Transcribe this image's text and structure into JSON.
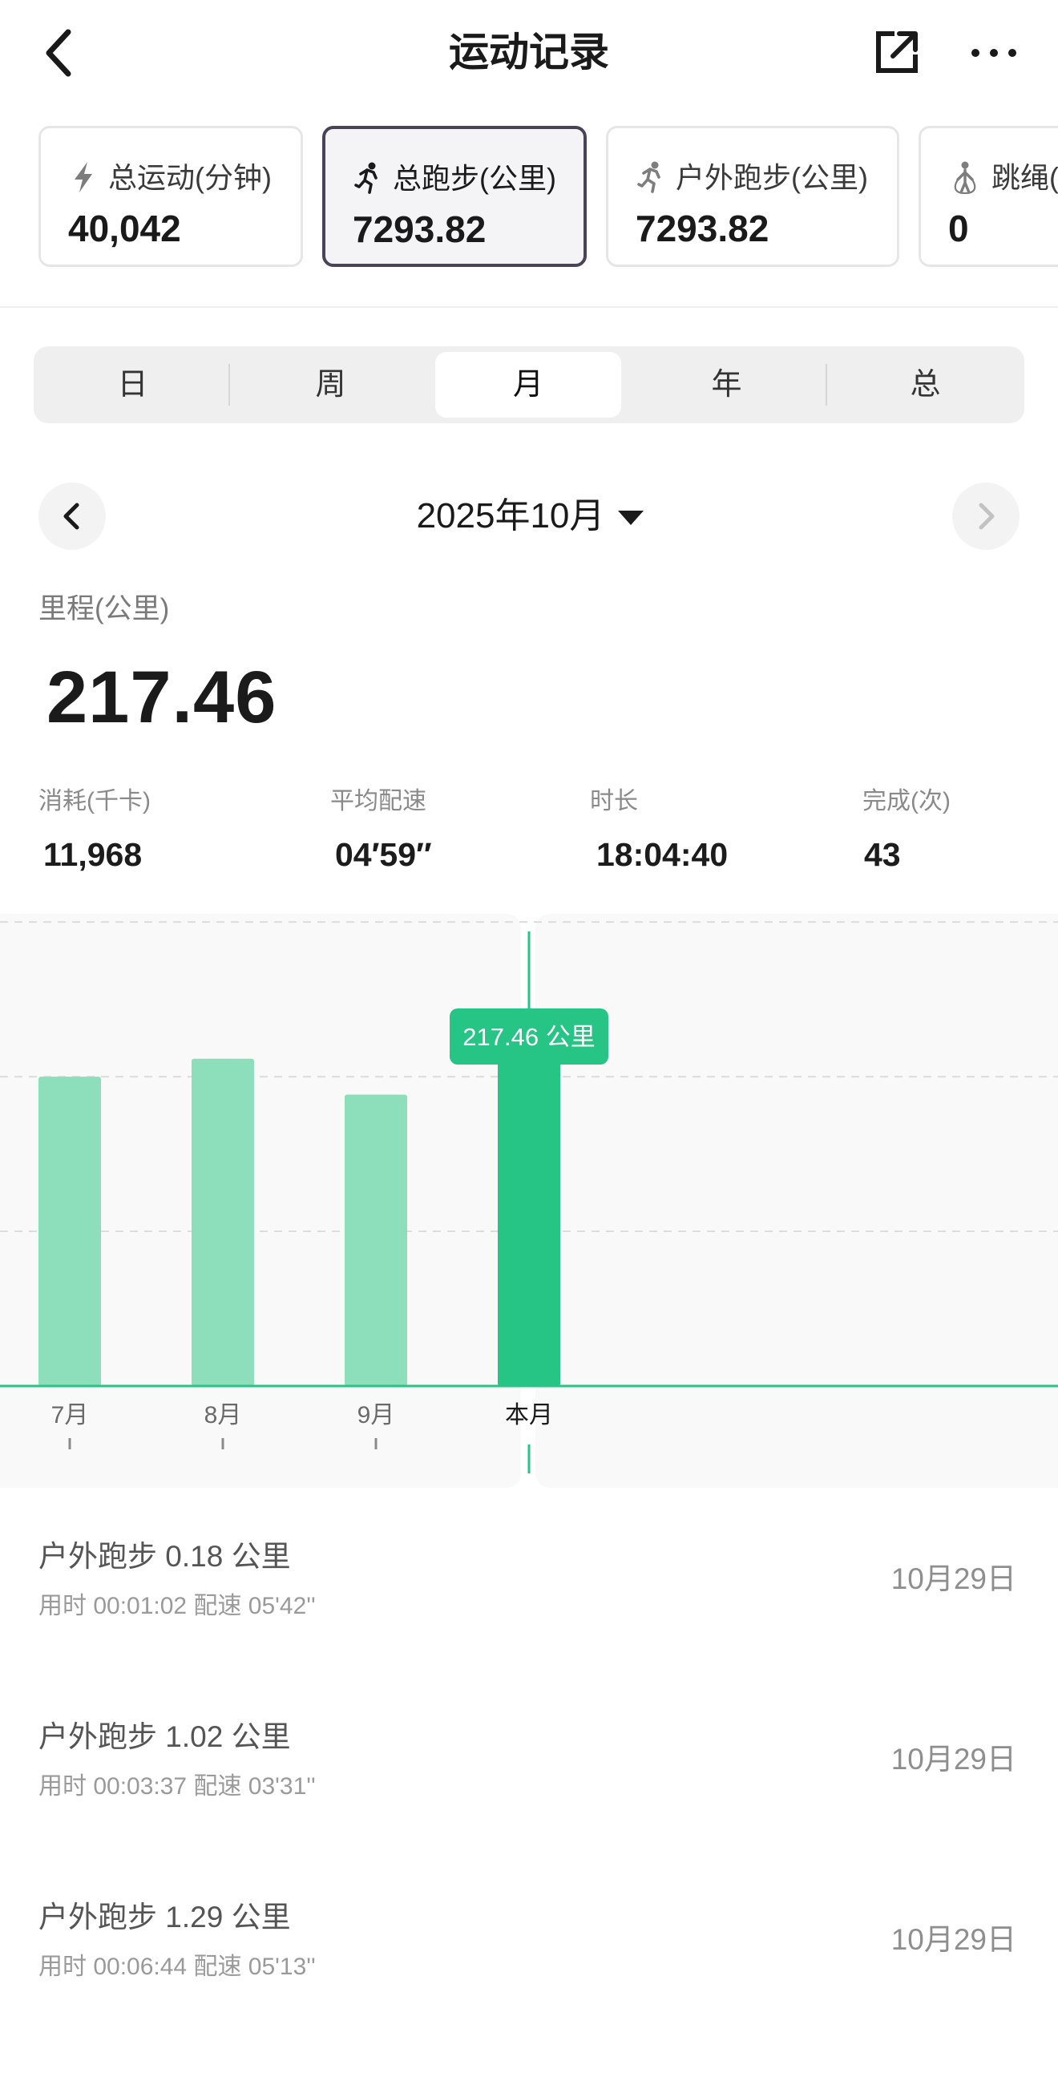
{
  "header": {
    "title": "运动记录"
  },
  "metric_cards": [
    {
      "label": "总运动(分钟)",
      "value": "40,042",
      "icon": "lightning-icon",
      "selected": false
    },
    {
      "label": "总跑步(公里)",
      "value": "7293.82",
      "icon": "runner-icon",
      "selected": true
    },
    {
      "label": "户外跑步(公里)",
      "value": "7293.82",
      "icon": "outdoor-runner-icon",
      "selected": false
    },
    {
      "label": "跳绳(",
      "value": "0",
      "icon": "jump-rope-icon",
      "selected": false
    }
  ],
  "period_tabs": {
    "items": [
      "日",
      "周",
      "月",
      "年",
      "总"
    ],
    "selected": "月"
  },
  "date_nav": {
    "label": "2025年10月"
  },
  "summary": {
    "distance_label": "里程(公里)",
    "distance_value": "217.46",
    "stats": [
      {
        "label": "消耗(千卡)",
        "value": "11,968"
      },
      {
        "label": "平均配速",
        "value": "04′59″"
      },
      {
        "label": "时长",
        "value": "18:04:40"
      },
      {
        "label": "完成(次)",
        "value": "43"
      }
    ]
  },
  "chart_data": {
    "type": "bar",
    "categories": [
      "7月",
      "8月",
      "9月",
      "本月"
    ],
    "values": [
      190,
      201,
      179,
      217.46
    ],
    "unit": "公里",
    "highlighted": "本月",
    "tooltip": "217.46 公里",
    "ylim": [
      0,
      290
    ],
    "grid_values": [
      95,
      190,
      285
    ],
    "colors": {
      "bar": "#8ddfbb",
      "bar_highlight": "#26c485",
      "axis": "#26c485",
      "grid": "#dcdcdc",
      "tooltip_bg": "#26c485"
    }
  },
  "records": [
    {
      "title": "户外跑步  0.18 公里",
      "detail": "用时 00:01:02    配速 05'42''",
      "date": "10月29日"
    },
    {
      "title": "户外跑步  1.02 公里",
      "detail": "用时 00:03:37    配速 03'31''",
      "date": "10月29日"
    },
    {
      "title": "户外跑步  1.29 公里",
      "detail": "用时 00:06:44    配速 05'13''",
      "date": "10月29日"
    }
  ]
}
